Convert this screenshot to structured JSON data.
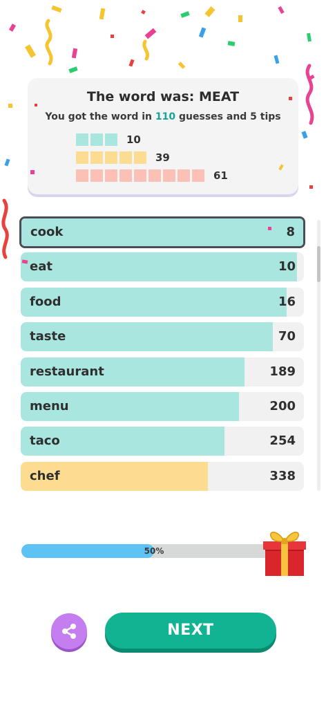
{
  "summary": {
    "title": "The word was: MEAT",
    "sub_prefix": "You got the word in",
    "guess_count": "110",
    "sub_suffix": "guesses and 5 tips",
    "stats": [
      {
        "squares": 3,
        "color": "#a8e6df",
        "value": "10"
      },
      {
        "squares": 5,
        "color": "#fcdc90",
        "value": "39"
      },
      {
        "squares": 9,
        "color": "#fbc1b6",
        "value": "61"
      }
    ]
  },
  "guesses": [
    {
      "word": "cook",
      "rank": "8",
      "fill_fraction": 1.0,
      "color": "#a8e6df",
      "selected": true
    },
    {
      "word": "eat",
      "rank": "10",
      "fill_fraction": 0.975,
      "color": "#a8e6df"
    },
    {
      "word": "food",
      "rank": "16",
      "fill_fraction": 0.94,
      "color": "#a8e6df"
    },
    {
      "word": "taste",
      "rank": "70",
      "fill_fraction": 0.89,
      "color": "#a8e6df"
    },
    {
      "word": "restaurant",
      "rank": "189",
      "fill_fraction": 0.79,
      "color": "#a8e6df"
    },
    {
      "word": "menu",
      "rank": "200",
      "fill_fraction": 0.77,
      "color": "#a8e6df"
    },
    {
      "word": "taco",
      "rank": "254",
      "fill_fraction": 0.72,
      "color": "#a8e6df"
    },
    {
      "word": "chef",
      "rank": "338",
      "fill_fraction": 0.66,
      "color": "#fcdc90"
    }
  ],
  "progress": {
    "label": "50%",
    "fraction": 0.5
  },
  "buttons": {
    "next_label": "NEXT",
    "share_icon": "share-icon"
  },
  "colors": {
    "accent": "#12b393",
    "progress": "#5ec2f4",
    "share": "#c47ef0"
  }
}
